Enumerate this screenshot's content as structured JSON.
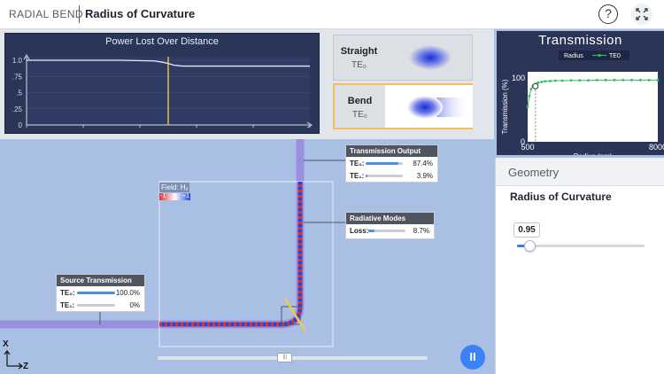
{
  "header": {
    "app_title": "RADIAL BEND",
    "page_title": "Radius of Curvature",
    "help_label": "?"
  },
  "power_chart": {
    "title": "Power Lost Over Distance",
    "y_ticks": [
      "1.0",
      ".75",
      ".5",
      ".25",
      "0"
    ],
    "y_tick_values": [
      1.0,
      0.75,
      0.5,
      0.25,
      0
    ],
    "ylim": [
      0,
      1.0
    ],
    "xlim": [
      0,
      1
    ],
    "x": [
      0,
      0.33,
      0.45,
      0.48,
      0.5,
      0.52,
      0.55,
      0.6,
      0.8,
      1.0
    ],
    "y": [
      1.0,
      1.0,
      0.99,
      0.97,
      0.95,
      0.925,
      0.91,
      0.91,
      0.91,
      0.91
    ],
    "marker_x": 0.5,
    "line_color": "#e8ecf5",
    "marker_color": "#f0c94a"
  },
  "modes": [
    {
      "name": "Straight",
      "mode": "TE₀",
      "selected": false
    },
    {
      "name": "Bend",
      "mode": "TE₀",
      "selected": true
    }
  ],
  "chart_data": {
    "type": "line",
    "title": "Transmission",
    "xlabel": "Radius (nm)",
    "ylabel": "Transmission (%)",
    "x_ticks": [
      "500",
      "8000"
    ],
    "y_ticks": [
      "100",
      "0"
    ],
    "xlim": [
      500,
      8000
    ],
    "ylim": [
      0,
      110
    ],
    "legend": {
      "label": "Radius",
      "series_label": "TE0",
      "placement": "top"
    },
    "series": [
      {
        "name": "TE0",
        "color": "#2fbf5a",
        "x": [
          500,
          600,
          700,
          800,
          950,
          1100,
          1300,
          1500,
          1800,
          2100,
          2500,
          3000,
          3500,
          4000,
          4500,
          5000,
          5500,
          6000,
          6500,
          7000,
          7500,
          8000
        ],
        "y": [
          55,
          72,
          83,
          88,
          91,
          93,
          94,
          95,
          95.5,
          96,
          96,
          96.5,
          96.5,
          96.5,
          97,
          97,
          97,
          97,
          97,
          97,
          97,
          97
        ]
      }
    ],
    "current_point": {
      "x": 950,
      "y": 87.4
    }
  },
  "geometry": {
    "title": "Geometry",
    "parameter_label": "Radius of Curvature",
    "slider_value": "0.95",
    "slider_fraction": 0.06
  },
  "transmission_output": {
    "title": "Transmission Output",
    "rows": [
      {
        "label": "TE₀:",
        "value": "87.4%",
        "fraction": 0.874
      },
      {
        "label": "TE₁:",
        "value": "3.9%",
        "fraction": 0.039
      }
    ]
  },
  "radiative_modes": {
    "title": "Radiative Modes",
    "rows": [
      {
        "label": "Loss:",
        "value": "8.7%",
        "fraction": 0.087
      }
    ]
  },
  "source_transmission": {
    "title": "Source Transmission",
    "rows": [
      {
        "label": "TE₀:",
        "value": "100.0%",
        "fraction": 1.0
      },
      {
        "label": "TE₁:",
        "value": "0%",
        "fraction": 0
      }
    ]
  },
  "field_legend": {
    "title": "Field: Hᵧ",
    "min": "-1",
    "max": "+1"
  },
  "timeline": {
    "fraction": 0.47,
    "pause_label": "II"
  },
  "axes": {
    "x": "X",
    "z": "Z"
  },
  "colors": {
    "waveguide": "#9b8fe0",
    "field_red": "#d63333",
    "field_blue": "#2244dd",
    "accent": "#3b82f6",
    "panel_dark": "#2a3557"
  }
}
